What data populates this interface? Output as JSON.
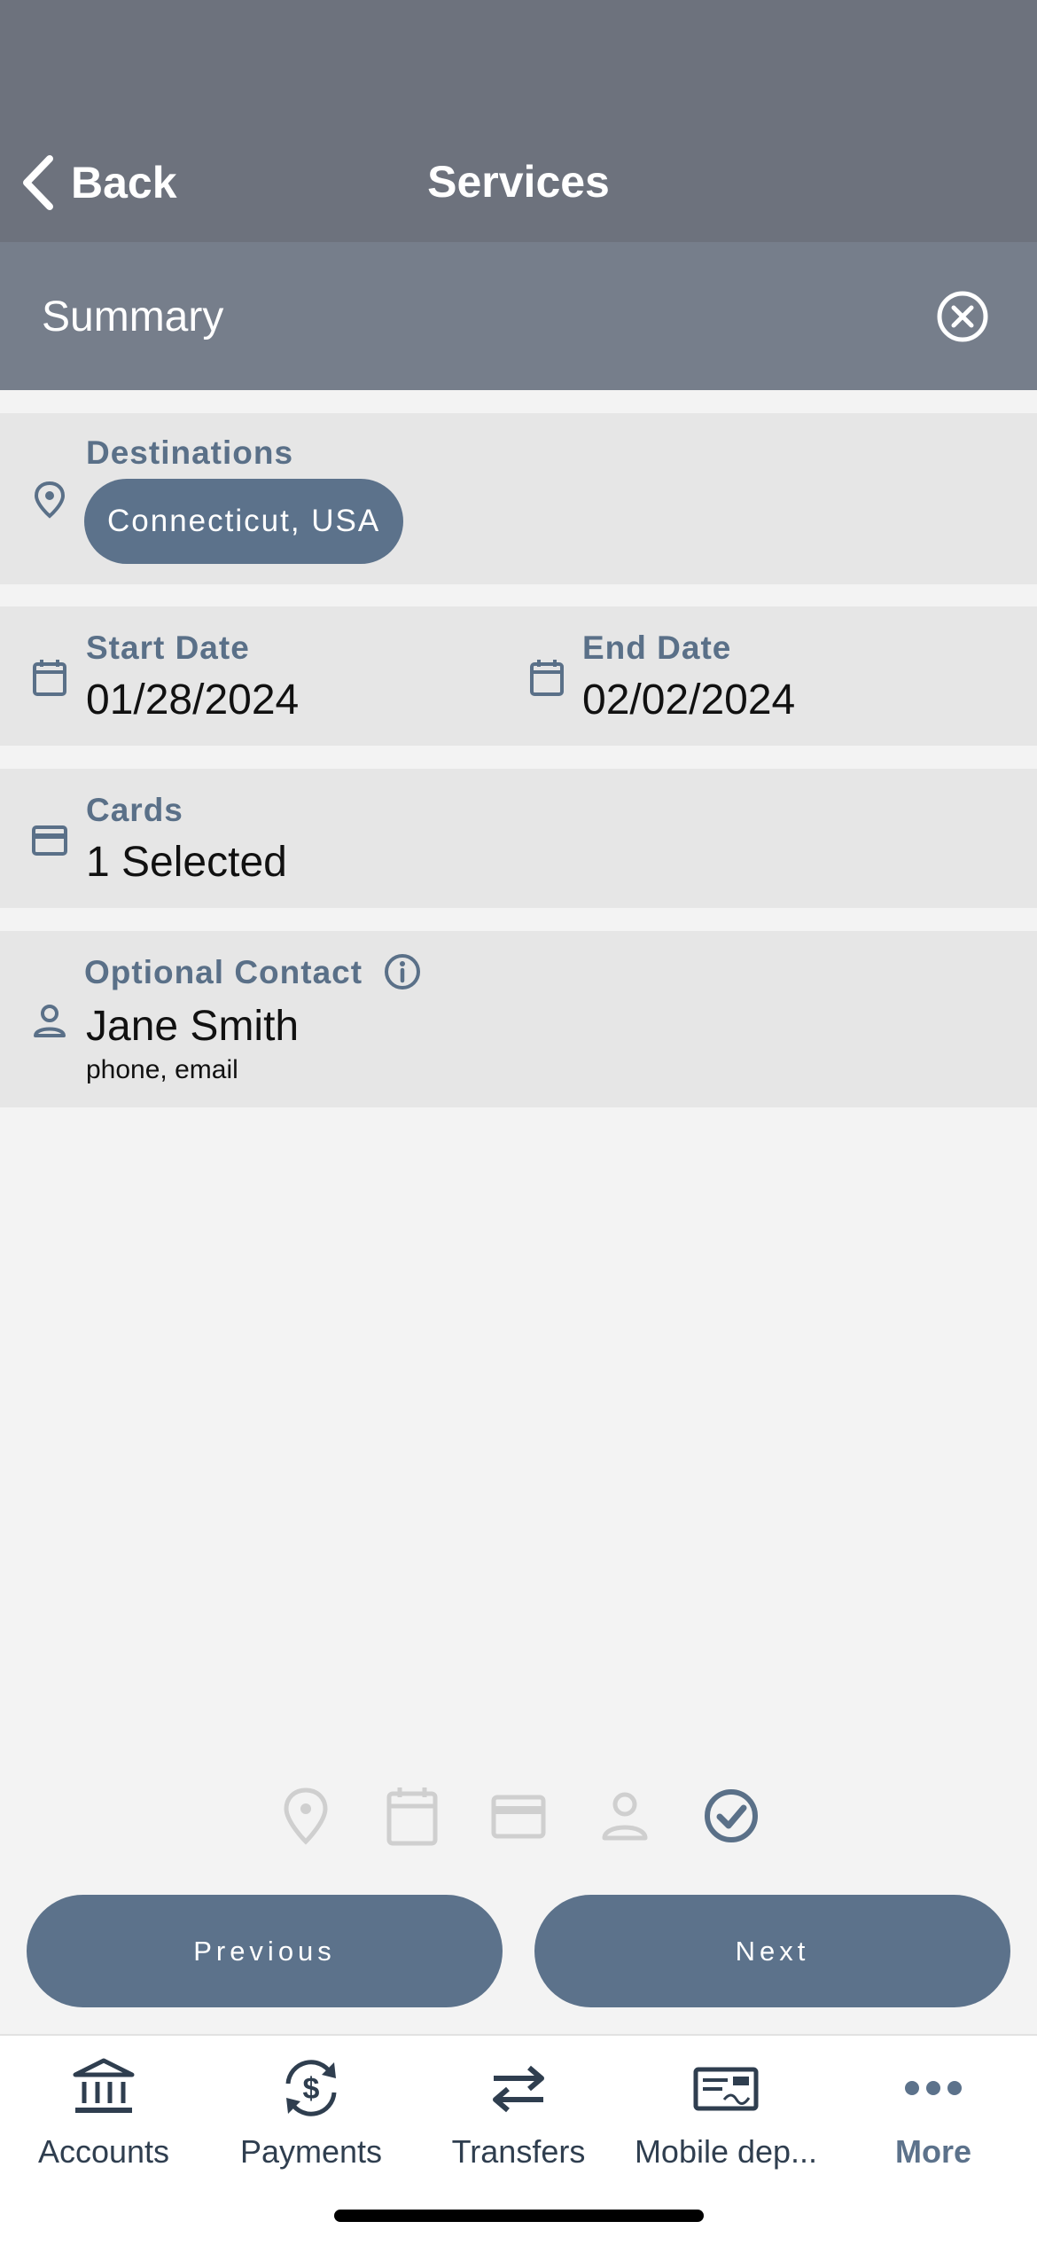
{
  "header": {
    "back_label": "Back",
    "title": "Services"
  },
  "summary": {
    "title": "Summary"
  },
  "destinations": {
    "label": "Destinations",
    "chip": "Connecticut, USA"
  },
  "dates": {
    "start_label": "Start Date",
    "start_value": "01/28/2024",
    "end_label": "End Date",
    "end_value": "02/02/2024"
  },
  "cards": {
    "label": "Cards",
    "value": "1 Selected"
  },
  "contact": {
    "label": "Optional Contact",
    "name": "Jane Smith",
    "details": "phone, email"
  },
  "steps": {
    "icons": [
      "location-pin-icon",
      "calendar-icon",
      "credit-card-icon",
      "person-icon",
      "check-circle-icon"
    ],
    "active_step": 5
  },
  "buttons": {
    "previous": "Previous",
    "next": "Next"
  },
  "tab_bar": {
    "items": [
      {
        "label": "Accounts",
        "icon": "bank-icon"
      },
      {
        "label": "Payments",
        "icon": "dollar-refresh-icon"
      },
      {
        "label": "Transfers",
        "icon": "swap-arrows-icon"
      },
      {
        "label": "Mobile dep...",
        "icon": "check-deposit-icon"
      },
      {
        "label": "More",
        "icon": "more-dots-icon"
      }
    ],
    "active": "More"
  },
  "colors": {
    "nav_bar": "#6d727d",
    "summary_bar": "#767e8b",
    "accent": "#5c728b",
    "label": "#5a7088",
    "card_bg": "#e6e6e6",
    "page_bg": "#f3f3f3"
  }
}
